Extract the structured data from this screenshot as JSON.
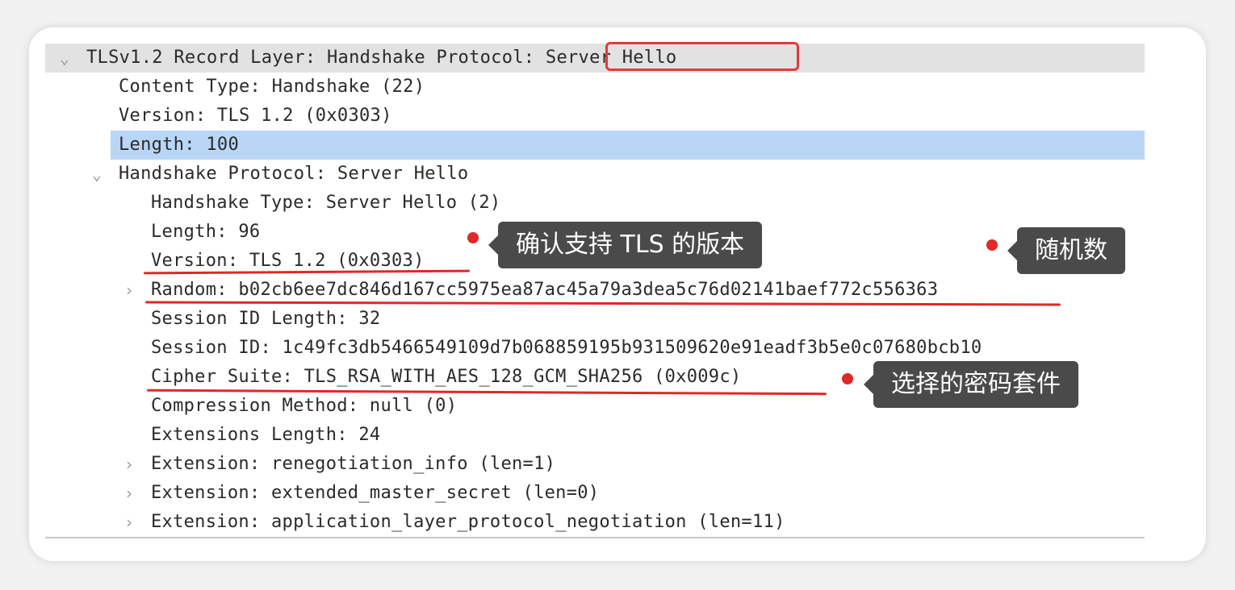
{
  "tree": {
    "rows": [
      {
        "text": "TLSv1.2 Record Layer: Handshake Protocol: Server Hello",
        "toggle": "⌄"
      },
      {
        "text": "Content Type: Handshake (22)"
      },
      {
        "text": "Version: TLS 1.2 (0x0303)"
      },
      {
        "text": "Length: 100"
      },
      {
        "text": "Handshake Protocol: Server Hello",
        "toggle": "⌄"
      },
      {
        "text": "Handshake Type: Server Hello (2)"
      },
      {
        "text": "Length: 96"
      },
      {
        "text": "Version: TLS 1.2 (0x0303)"
      },
      {
        "text": "Random: b02cb6ee7dc846d167cc5975ea87ac45a79a3dea5c76d02141baef772c556363",
        "toggle": "›"
      },
      {
        "text": "Session ID Length: 32"
      },
      {
        "text": "Session ID: 1c49fc3db5466549109d7b068859195b931509620e91eadf3b5e0c07680bcb10"
      },
      {
        "text": "Cipher Suite: TLS_RSA_WITH_AES_128_GCM_SHA256 (0x009c)"
      },
      {
        "text": "Compression Method: null (0)"
      },
      {
        "text": "Extensions Length: 24"
      },
      {
        "text": "Extension: renegotiation_info (len=1)",
        "toggle": "›"
      },
      {
        "text": "Extension: extended_master_secret (len=0)",
        "toggle": "›"
      },
      {
        "text": "Extension: application_layer_protocol_negotiation (len=11)",
        "toggle": "›"
      }
    ]
  },
  "annotations": {
    "version_note": "确认支持 TLS 的版本",
    "random_note": "随机数",
    "cipher_note": "选择的密码套件"
  },
  "colors": {
    "selected_row": "#b9d6f6",
    "header_row": "#e2e2e2",
    "annotation_red": "#e02828",
    "callout_bg": "#4a4a4a"
  }
}
